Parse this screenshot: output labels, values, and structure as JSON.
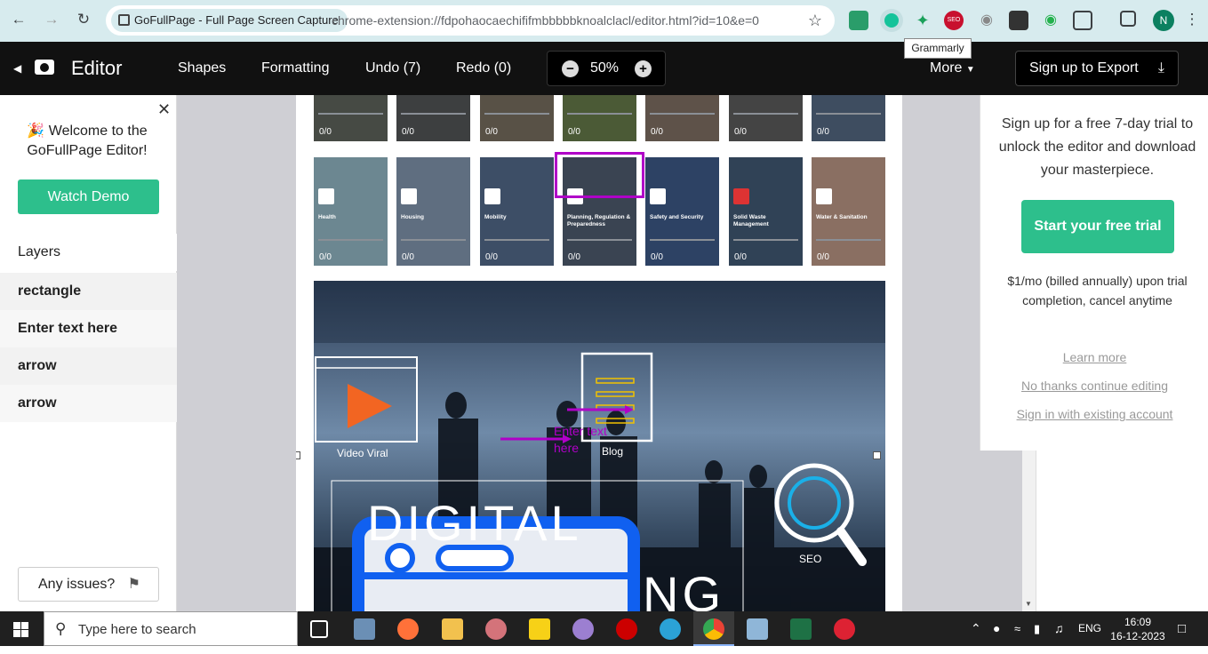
{
  "browser": {
    "tab_title": "GoFullPage - Full Page Screen Capture",
    "url": "chrome-extension://fdpohaocaechififmbbbbbknoalclacl/editor.html?id=10&e=0",
    "profile_initial": "N",
    "tooltip": "Grammarly",
    "ext_seo_label": "SEO"
  },
  "editor": {
    "title": "Editor",
    "shapes": "Shapes",
    "formatting": "Formatting",
    "undo": "Undo (7)",
    "redo": "Redo (0)",
    "zoom": "50%",
    "more": "More",
    "export": "Sign up to Export"
  },
  "sidebar": {
    "welcome": "Welcome to the GoFullPage Editor!",
    "watch_demo": "Watch Demo",
    "layers_title": "Layers",
    "layers": [
      "rectangle",
      "Enter text here",
      "arrow",
      "arrow"
    ],
    "issues": "Any issues?"
  },
  "canvas": {
    "top_row_counts": [
      "0/0",
      "0/0",
      "0/0",
      "0/0",
      "0/0",
      "0/0",
      "0/0"
    ],
    "tiles": [
      {
        "label": "Health",
        "count": "0/0"
      },
      {
        "label": "Housing",
        "count": "0/0"
      },
      {
        "label": "Mobility",
        "count": "0/0"
      },
      {
        "label": "Planning, Regulation & Preparedness",
        "count": "0/0"
      },
      {
        "label": "Safety and Security",
        "count": "0/0"
      },
      {
        "label": "Solid Waste Management",
        "count": "0/0"
      },
      {
        "label": "Water & Sanitation",
        "count": "0/0"
      }
    ],
    "hero": {
      "video_viral": "Video Viral",
      "blog": "Blog",
      "seo": "SEO",
      "text_annotation": "Enter text here",
      "big_text_top": "DIGITAL",
      "big_text_bottom": "NG"
    }
  },
  "upsell": {
    "message": "Sign up for a free 7-day trial to unlock the editor and download your masterpiece.",
    "trial_button": "Start your free trial",
    "price": "$1/mo (billed annually) upon trial completion, cancel anytime",
    "learn_more": "Learn more",
    "no_thanks": "No thanks continue editing",
    "sign_in": "Sign in with existing account"
  },
  "taskbar": {
    "search_placeholder": "Type here to search",
    "lang": "ENG",
    "time": "16:09",
    "date": "16-12-2023"
  }
}
